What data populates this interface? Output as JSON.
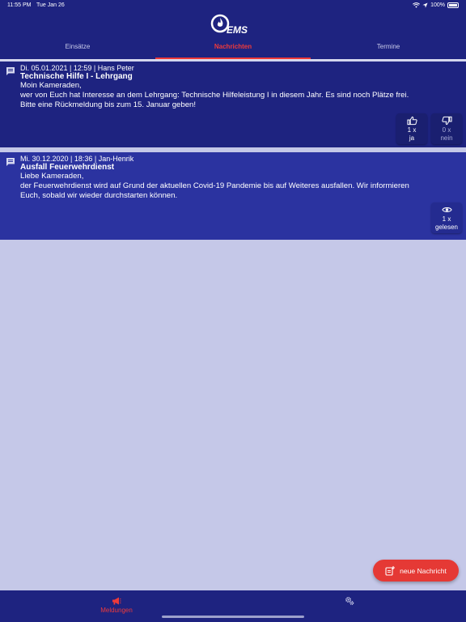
{
  "status": {
    "time": "11:55 PM",
    "date": "Tue Jan 26",
    "battery": "100%"
  },
  "app": {
    "logo_text": "EMS"
  },
  "tabs": [
    {
      "label": "Einsätze",
      "active": false
    },
    {
      "label": "Nachrichten",
      "active": true
    },
    {
      "label": "Termine",
      "active": false
    }
  ],
  "colors": {
    "brand": "#1e2380",
    "accent": "#ee3a3a",
    "background": "#c5c8e8"
  },
  "messages": [
    {
      "meta": "Di. 05.01.2021 | 12:59 | Hans Peter",
      "title": "Technische Hilfe I - Lehrgang",
      "body_lines": [
        "Moin Kameraden,",
        "wer von Euch hat Interesse an dem Lehrgang: Technische Hilfeleistung I in diesem Jahr. Es sind noch Plätze frei.",
        "Bitte eine Rückmeldung bis zum 15. Januar geben!"
      ],
      "reactions": [
        {
          "icon": "thumbs-up-icon",
          "count": "1 x",
          "label": "ja"
        },
        {
          "icon": "thumbs-down-icon",
          "count": "0 x",
          "label": "nein"
        }
      ]
    },
    {
      "meta": "Mi. 30.12.2020 | 18:36 | Jan-Henrik",
      "title": "Ausfall Feuerwehrdienst",
      "body_lines": [
        "Liebe Kameraden,",
        "der Feuerwehrdienst wird auf Grund der aktuellen Covid-19 Pandemie bis auf Weiteres ausfallen. Wir informieren",
        "Euch, sobald wir wieder durchstarten können."
      ],
      "reactions": [
        {
          "icon": "eye-icon",
          "count": "1 x",
          "label": "gelesen"
        }
      ]
    }
  ],
  "fab": {
    "label": "neue Nachricht",
    "icon": "new-message-icon"
  },
  "bottom_nav": [
    {
      "label": "Meldungen",
      "icon": "megaphone-icon",
      "active": true
    },
    {
      "label": "",
      "icon": "settings-gears-icon",
      "active": false
    }
  ]
}
